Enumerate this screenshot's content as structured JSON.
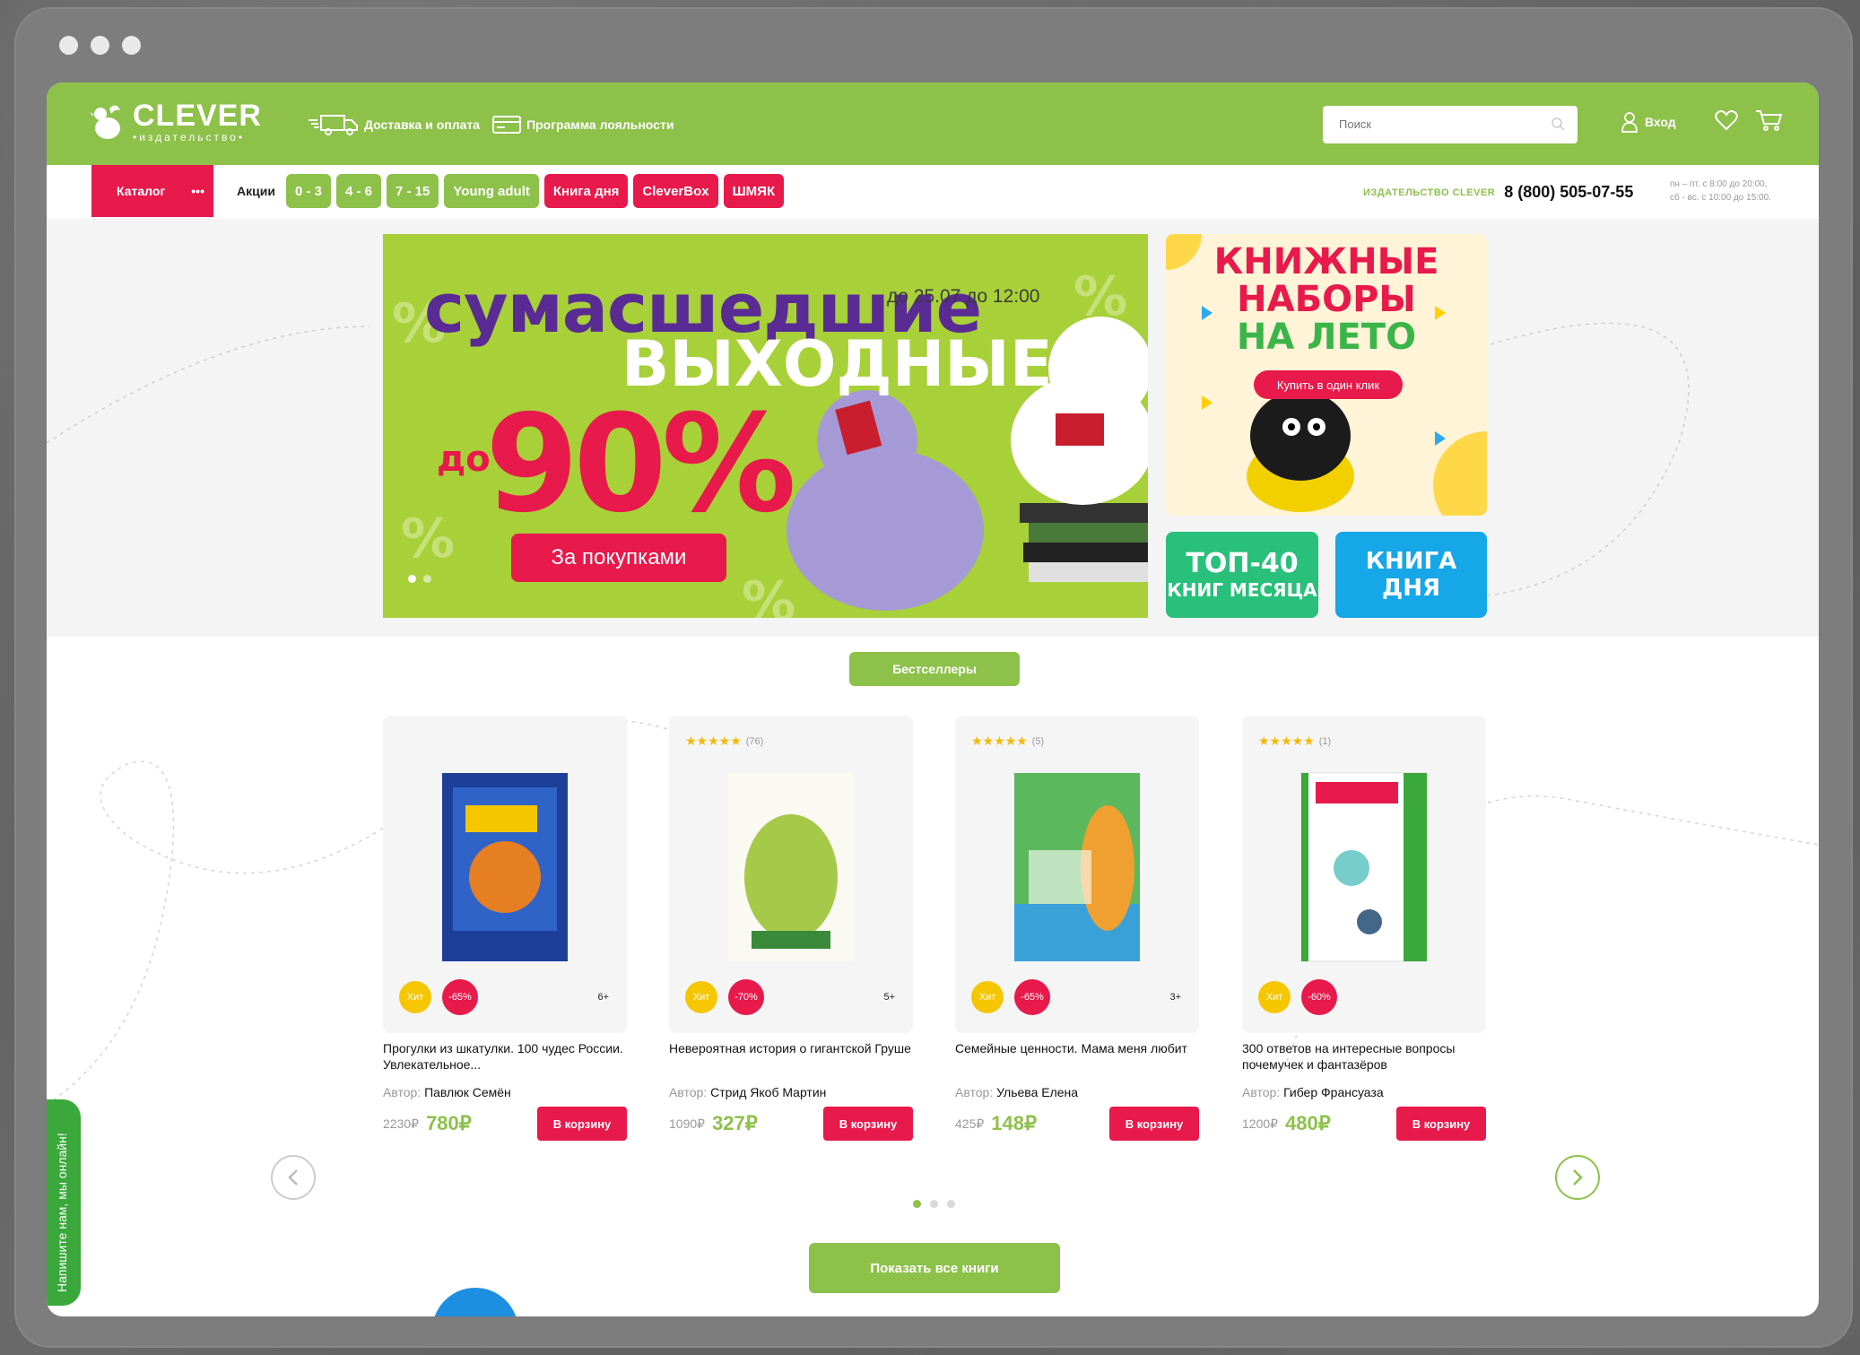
{
  "header": {
    "logo_name": "CLEVER",
    "logo_sub": "•издательство•",
    "delivery": "Доставка и оплата",
    "loyalty": "Программа лояльности",
    "search_placeholder": "Поиск",
    "login": "Вход"
  },
  "nav": {
    "catalog": "Каталог",
    "catalog_more": "•••",
    "promo_label": "Акции",
    "chips": [
      "0 - 3",
      "4 - 6",
      "7 - 15",
      "Young adult",
      "Книга дня",
      "CleverBox",
      "ШМЯК"
    ],
    "publisher": "ИЗДАТЕЛЬСТВО CLEVER",
    "phone": "8 (800) 505-07-55",
    "hours_1": "пн – пт. с 8:00 до 20:00,",
    "hours_2": "сб - вс. с 10:00 до 15:00."
  },
  "banner": {
    "title_1": "сумасшедшие",
    "date": "до 25.07 до 12:00",
    "title_2": "ВЫХОДНЫЕ",
    "prefix": "до",
    "percent": "90%",
    "button": "За покупками"
  },
  "side_banners": {
    "summer_1": "КНИЖНЫЕ",
    "summer_2": "НАБОРЫ",
    "summer_3": "НА ЛЕТО",
    "summer_button": "Купить в один клик",
    "top40_1": "ТОП-40",
    "top40_2": "КНИГ МЕСЯЦА",
    "bookday_1": "КНИГА",
    "bookday_2": "ДНЯ"
  },
  "bestsellers": {
    "tab": "Бестселлеры",
    "author_label": "Автор:",
    "cart_label": "В корзину",
    "hit_label": "Хит",
    "products": [
      {
        "title": "Прогулки из шкатулки. 100 чудес России. Увлекательное...",
        "author": "Павлюк Семён",
        "old_price": "2230₽",
        "price": "780₽",
        "discount": "-65%",
        "age": "6+",
        "rating_count": ""
      },
      {
        "title": "Невероятная история о гигантской Груше",
        "author": "Стрид Якоб Мартин",
        "old_price": "1090₽",
        "price": "327₽",
        "discount": "-70%",
        "age": "5+",
        "rating_count": "(76)"
      },
      {
        "title": "Семейные ценности. Мама меня любит",
        "author": "Ульева Елена",
        "old_price": "425₽",
        "price": "148₽",
        "discount": "-65%",
        "age": "3+",
        "rating_count": "(5)"
      },
      {
        "title": "300 ответов на интересные вопросы почемучек и фантазёров",
        "author": "Гибер Франсуаза",
        "old_price": "1200₽",
        "price": "480₽",
        "discount": "-60%",
        "age": "",
        "rating_count": "(1)"
      }
    ],
    "show_all": "Показать все книги"
  },
  "chat": "Напишите нам, мы онлайн!",
  "colors": {
    "brand_green": "#8dc14a",
    "accent_red": "#e8194b"
  }
}
